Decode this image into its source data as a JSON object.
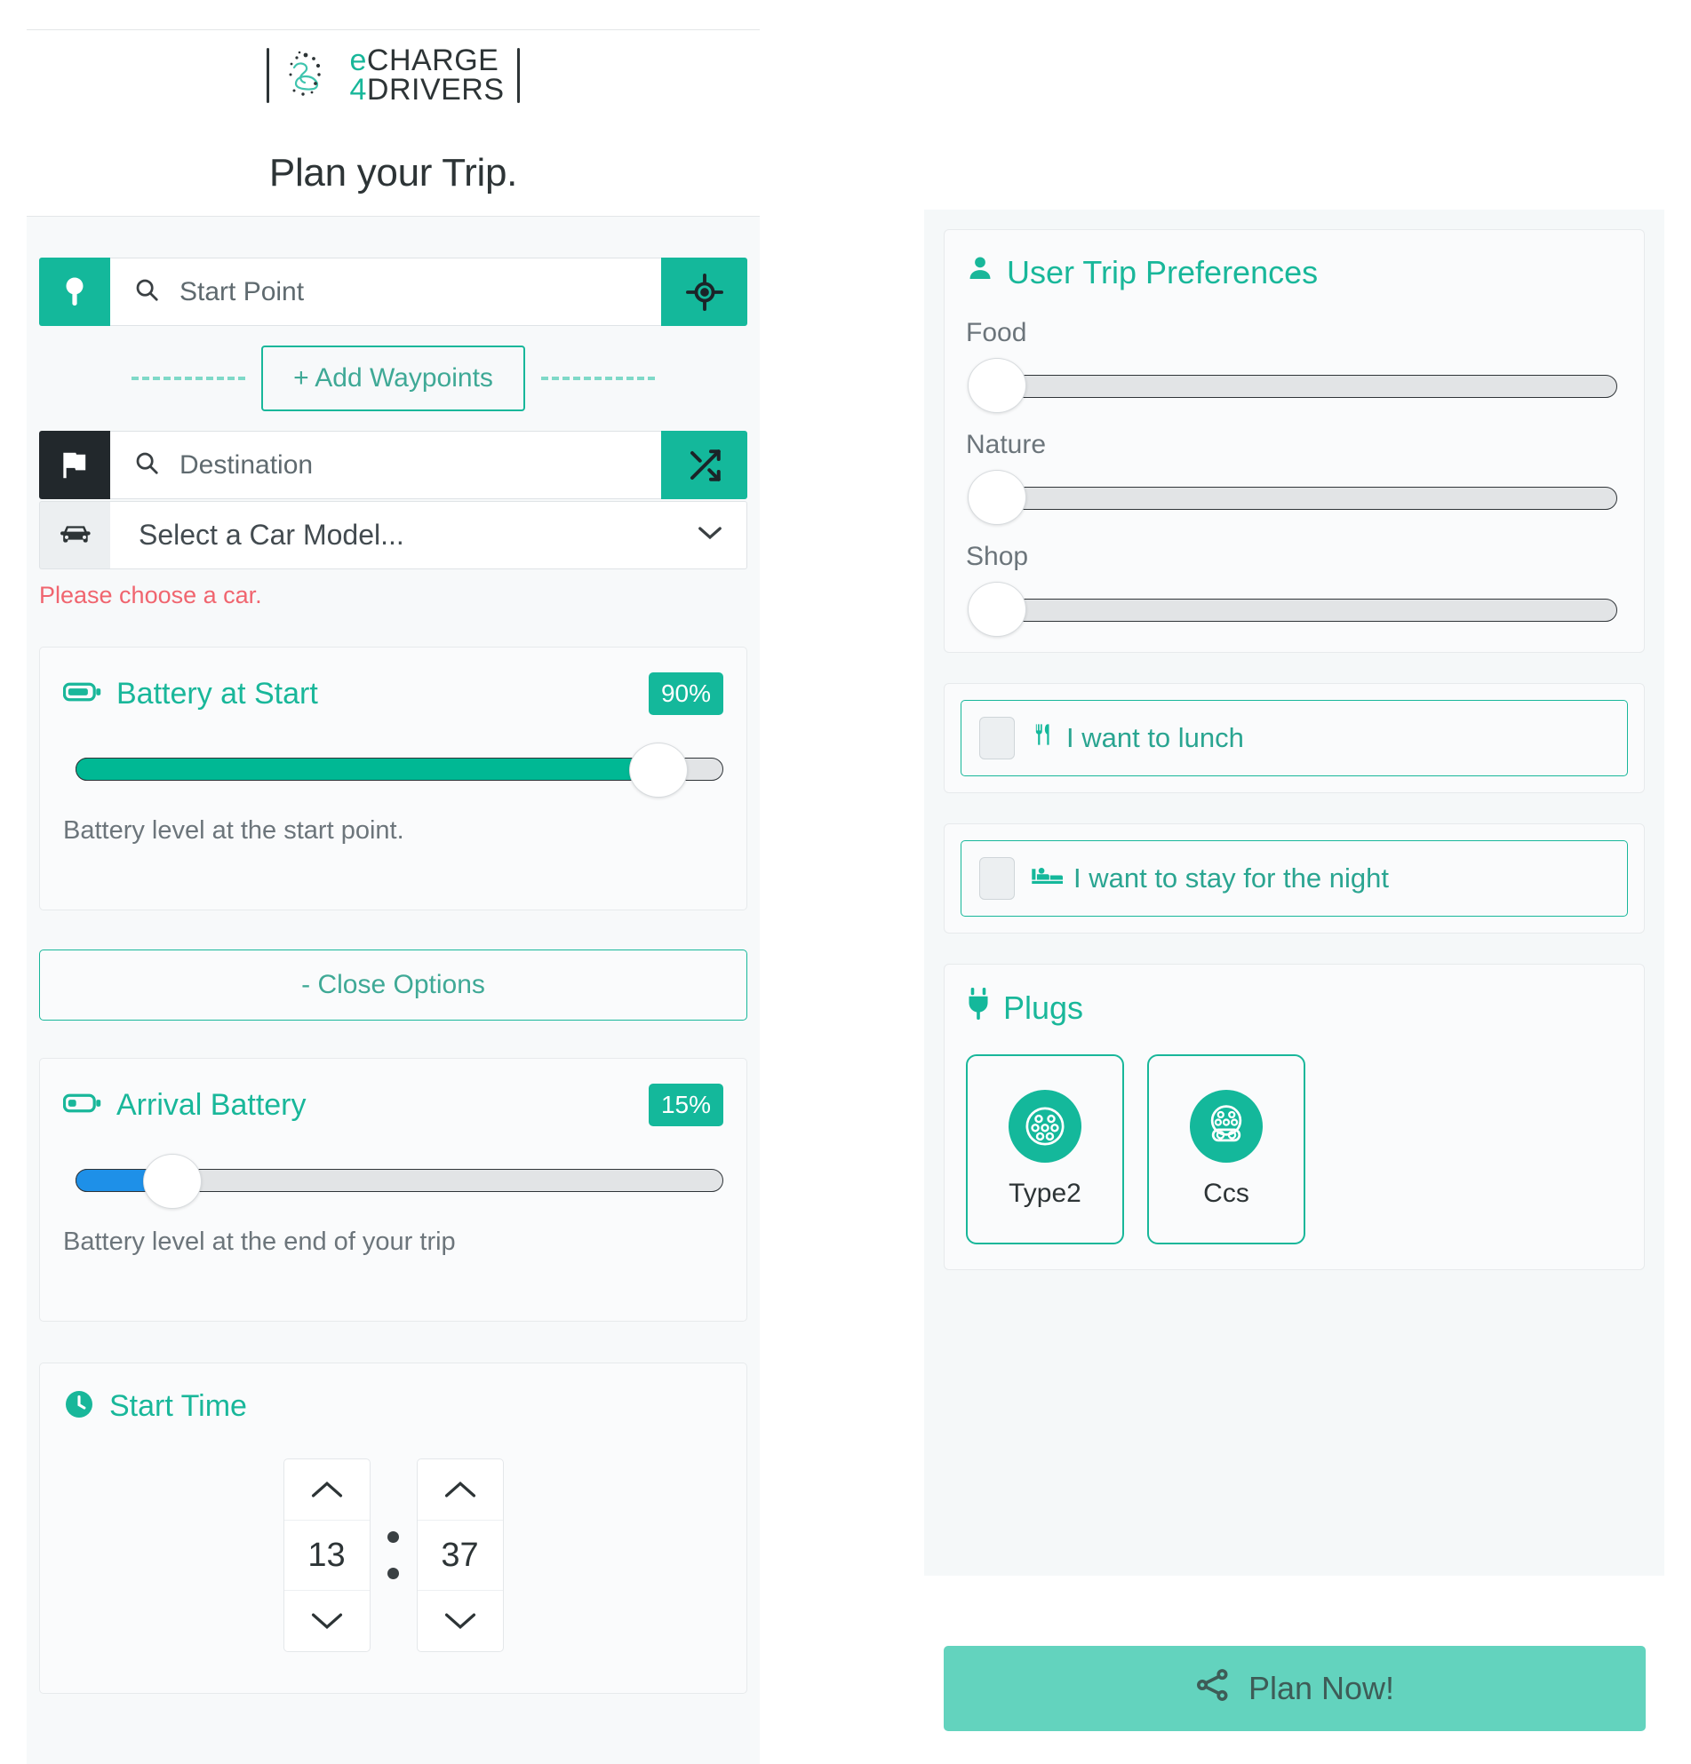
{
  "brand": {
    "name_line1": "eCHARGE",
    "name_line2": "4DRIVERS",
    "e_letter": "e",
    "rest_line1": "CHARGE",
    "four": "4",
    "rest_line2": "DRIVERS",
    "logo_icon": "ev-car-logo-icon"
  },
  "page": {
    "title": "Plan your Trip."
  },
  "trip_form": {
    "start": {
      "prefix_icon": "map-pin-icon",
      "search_icon": "search-icon",
      "placeholder": "Start Point",
      "value": "",
      "suffix_icon": "crosshair-locate-icon",
      "prefix_color": "#14b89b",
      "suffix_color": "#14b89b"
    },
    "waypoints": {
      "label": "+ Add Waypoints"
    },
    "destination": {
      "prefix_icon": "flag-icon",
      "search_icon": "search-icon",
      "placeholder": "Destination",
      "value": "",
      "suffix_icon": "shuffle-icon",
      "prefix_color": "#22282c",
      "suffix_color": "#14b89b"
    },
    "car": {
      "prefix_icon": "car-icon",
      "selected": "Select a Car Model...",
      "chevron_icon": "chevron-down-icon",
      "error": "Please choose a car.",
      "error_color": "#f0656f"
    }
  },
  "battery_start": {
    "icon": "battery-icon",
    "title": "Battery at Start",
    "badge": "90%",
    "value": 90,
    "help": "Battery level at the start point.",
    "fill_color": "#00b894"
  },
  "close_options": {
    "label": "- Close Options"
  },
  "arrival_battery": {
    "icon": "battery-icon",
    "title": "Arrival Battery",
    "badge": "15%",
    "value": 15,
    "help": "Battery level at the end of your trip",
    "fill_color": "#1e90e8"
  },
  "start_time": {
    "icon": "clock-icon",
    "title": "Start Time",
    "hours": "13",
    "minutes": "37",
    "up_icon": "chevron-up-icon",
    "down_icon": "chevron-down-icon"
  },
  "preferences": {
    "icon": "user-icon",
    "title": "User Trip Preferences",
    "sliders": [
      {
        "label": "Food",
        "value": 0
      },
      {
        "label": "Nature",
        "value": 0
      },
      {
        "label": "Shop",
        "value": 0
      }
    ]
  },
  "options": [
    {
      "icon": "cutlery-icon",
      "label": "I want to lunch",
      "checked": false
    },
    {
      "icon": "bed-icon",
      "label": "I want to stay for the night",
      "checked": false
    }
  ],
  "plugs": {
    "icon": "plug-icon",
    "title": "Plugs",
    "items": [
      {
        "name": "Type2",
        "icon": "type2-connector-icon",
        "selected": true
      },
      {
        "name": "Ccs",
        "icon": "ccs-connector-icon",
        "selected": true
      }
    ]
  },
  "plan_button": {
    "icon": "route-share-icon",
    "label": "Plan Now!",
    "color": "#63d3be"
  },
  "theme": {
    "accent": "#14b89b",
    "accent_text": "#19b79a",
    "dark": "#22282c",
    "panel_bg": "#f7f9fa",
    "right_bg": "#f5f8f9",
    "error": "#f0656f",
    "blue": "#1e90e8"
  }
}
